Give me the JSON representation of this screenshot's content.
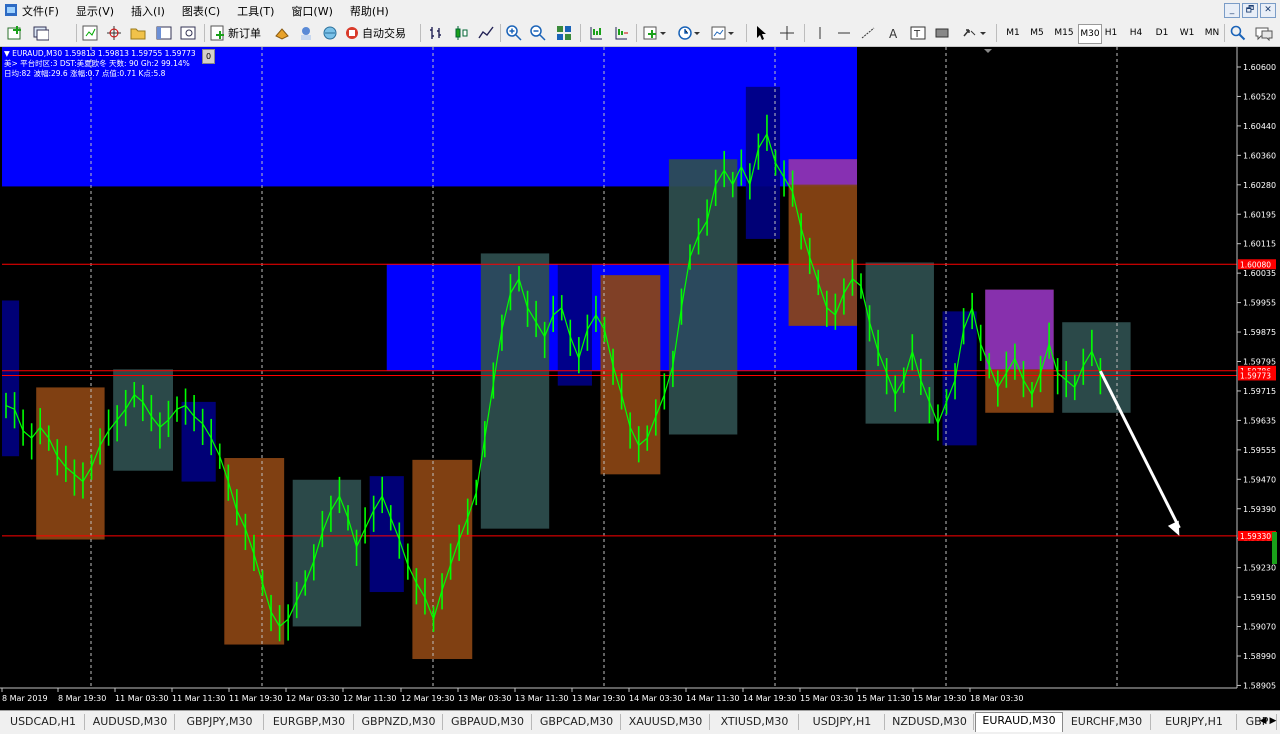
{
  "menu": [
    "文件(F)",
    "显示(V)",
    "插入(I)",
    "图表(C)",
    "工具(T)",
    "窗口(W)",
    "帮助(H)"
  ],
  "window_buttons": [
    "_",
    "🗗",
    "✕"
  ],
  "toolbar": {
    "new_order_label": "新订单",
    "auto_trading_label": "自动交易",
    "timeframes": [
      "M1",
      "M5",
      "M15",
      "M30",
      "H1",
      "H4",
      "D1",
      "W1",
      "MN"
    ],
    "active_timeframe": "M30"
  },
  "chart": {
    "header_line1": "EURAUD,M30  1.59813 1.59813 1.59755 1.59773",
    "header_line2": "美> 平台时区:3  DST:美夏欧冬 天数: 90  Gh:2  99.14%",
    "header_line3": "日均:82  波幅:29.6  涨幅:0.7  点值:0.71  K点:5.8",
    "zero_badge": "0",
    "colors": {
      "background": "#000000",
      "candles": "#00ff00",
      "blue_zone": "#0000ff",
      "navy_box": "#000080",
      "brown_box": "#8b4513",
      "slate_box": "#2f4f4f",
      "purple_box": "#8a2be2",
      "hline": "#ff0000",
      "grid": "#c0c0c0"
    }
  },
  "chart_data": {
    "type": "line",
    "symbol": "EURAUD",
    "timeframe": "M30",
    "ylim": [
      1.5891,
      1.6068
    ],
    "y_ticks": [
      "1.60600",
      "1.60520",
      "1.60440",
      "1.60360",
      "1.60280",
      "1.60195",
      "1.60115",
      "1.60035",
      "1.59955",
      "1.59875",
      "1.59795",
      "1.59715",
      "1.59635",
      "1.59555",
      "1.59470",
      "1.59390",
      "1.59310",
      "1.59230",
      "1.59150",
      "1.59070",
      "1.58990",
      "1.58905"
    ],
    "x_ticks": [
      "8 Mar 2019",
      "8 Mar 19:30",
      "11 Mar 03:30",
      "11 Mar 11:30",
      "11 Mar 19:30",
      "12 Mar 03:30",
      "12 Mar 11:30",
      "12 Mar 19:30",
      "13 Mar 03:30",
      "13 Mar 11:30",
      "13 Mar 19:30",
      "14 Mar 03:30",
      "14 Mar 11:30",
      "14 Mar 19:30",
      "15 Mar 03:30",
      "15 Mar 11:30",
      "15 Mar 19:30",
      "18 Mar 03:30"
    ],
    "price_labels": [
      {
        "text": "1.60080",
        "value": 1.6008
      },
      {
        "text": "1.59786",
        "value": 1.59786
      },
      {
        "text": "1.59773",
        "value": 1.59773
      },
      {
        "text": "1.59330",
        "value": 1.5933
      }
    ],
    "horizontal_lines": [
      1.6008,
      1.59786,
      1.59773,
      1.5933
    ],
    "blue_zones": [
      {
        "x_start": 0,
        "x_end": 100,
        "y_top": 1.6068,
        "y_bottom": 1.60295
      },
      {
        "x_start": 45,
        "x_end": 100,
        "y_top": 1.6008,
        "y_bottom": 1.59786
      }
    ],
    "boxes": [
      {
        "x": -1,
        "w": 3,
        "hi": 1.5998,
        "lo": 1.5955,
        "color": "navy"
      },
      {
        "x": 4,
        "w": 8,
        "hi": 1.5974,
        "lo": 1.5932,
        "color": "brown"
      },
      {
        "x": 13,
        "w": 7,
        "hi": 1.5979,
        "lo": 1.5951,
        "color": "slate"
      },
      {
        "x": 21,
        "w": 4,
        "hi": 1.597,
        "lo": 1.5948,
        "color": "navy"
      },
      {
        "x": 26,
        "w": 7,
        "hi": 1.59545,
        "lo": 1.5903,
        "color": "brown"
      },
      {
        "x": 34,
        "w": 8,
        "hi": 1.59485,
        "lo": 1.5908,
        "color": "slate"
      },
      {
        "x": 43,
        "w": 4,
        "hi": 1.59495,
        "lo": 1.59175,
        "color": "navy"
      },
      {
        "x": 48,
        "w": 7,
        "hi": 1.5954,
        "lo": 1.5899,
        "color": "brown"
      },
      {
        "x": 56,
        "w": 8,
        "hi": 1.6011,
        "lo": 1.5935,
        "color": "slate"
      },
      {
        "x": 65,
        "w": 4,
        "hi": 1.6008,
        "lo": 1.59745,
        "color": "navy"
      },
      {
        "x": 70,
        "w": 7,
        "hi": 1.6005,
        "lo": 1.595,
        "color": "brown"
      },
      {
        "x": 78,
        "w": 8,
        "hi": 1.6037,
        "lo": 1.5961,
        "color": "slate"
      },
      {
        "x": 87,
        "w": 4,
        "hi": 1.6057,
        "lo": 1.6015,
        "color": "navy"
      },
      {
        "x": 92,
        "w": 8,
        "hi": 1.6037,
        "lo": 1.5991,
        "color": "brown"
      },
      {
        "x": 92,
        "w": 8,
        "hi": 1.6037,
        "lo": 1.603,
        "color": "purple"
      },
      {
        "x": 101,
        "w": 8,
        "hi": 1.60085,
        "lo": 1.5964,
        "color": "slate"
      },
      {
        "x": 110,
        "w": 4,
        "hi": 1.5995,
        "lo": 1.5958,
        "color": "navy"
      },
      {
        "x": 115,
        "w": 8,
        "hi": 1.6001,
        "lo": 1.5967,
        "color": "brown"
      },
      {
        "x": 115,
        "w": 8,
        "hi": 1.6001,
        "lo": 1.5979,
        "color": "purple"
      },
      {
        "x": 124,
        "w": 8,
        "hi": 1.5992,
        "lo": 1.5967,
        "color": "slate"
      }
    ],
    "series": [
      {
        "x": [
          0,
          1,
          2,
          3,
          4,
          5,
          6,
          7,
          8,
          9,
          10,
          11,
          12,
          13,
          14,
          15,
          16,
          17,
          18,
          19,
          20,
          21,
          22,
          23,
          24,
          25,
          26,
          27,
          28,
          29,
          30,
          31,
          32,
          33,
          34,
          35,
          36,
          37,
          38,
          39,
          40,
          41,
          42,
          43,
          44,
          45,
          46,
          47,
          48,
          49,
          50,
          51,
          52,
          53,
          54,
          55,
          56,
          57,
          58,
          59,
          60,
          61,
          62,
          63,
          64,
          65,
          66,
          67,
          68,
          69,
          70,
          71,
          72,
          73,
          74,
          75,
          76,
          77,
          78,
          79,
          80,
          81,
          82,
          83,
          84,
          85,
          86,
          87,
          88,
          89,
          90,
          91,
          92,
          93,
          94,
          95,
          96,
          97,
          98,
          99,
          100,
          101,
          102,
          103,
          104,
          105,
          106,
          107,
          108,
          109,
          110,
          111,
          112,
          113,
          114,
          115,
          116,
          117,
          118,
          119,
          120,
          121,
          122,
          123,
          124,
          125,
          126,
          127,
          128
        ],
        "values": [
          1.5969,
          1.5968,
          1.5962,
          1.596,
          1.5963,
          1.596,
          1.5955,
          1.5952,
          1.595,
          1.5948,
          1.5952,
          1.5958,
          1.5962,
          1.5965,
          1.5968,
          1.5972,
          1.597,
          1.5966,
          1.5963,
          1.5965,
          1.5968,
          1.5969,
          1.5966,
          1.5964,
          1.596,
          1.5955,
          1.5948,
          1.594,
          1.5935,
          1.5928,
          1.592,
          1.5912,
          1.5908,
          1.591,
          1.5915,
          1.592,
          1.5926,
          1.5934,
          1.594,
          1.5944,
          1.5938,
          1.593,
          1.5935,
          1.594,
          1.5944,
          1.5938,
          1.5932,
          1.5925,
          1.592,
          1.5916,
          1.591,
          1.5918,
          1.5925,
          1.5932,
          1.5938,
          1.5945,
          1.596,
          1.5975,
          1.599,
          1.6,
          1.6004,
          1.5996,
          1.5992,
          1.5988,
          1.5994,
          1.5996,
          1.5988,
          1.5982,
          1.599,
          1.5994,
          1.599,
          1.598,
          1.5972,
          1.5963,
          1.5958,
          1.596,
          1.5966,
          1.5972,
          1.598,
          1.5996,
          1.601,
          1.6016,
          1.602,
          1.603,
          1.6034,
          1.603,
          1.6035,
          1.603,
          1.604,
          1.6044,
          1.6036,
          1.6032,
          1.6028,
          1.6018,
          1.601,
          1.6003,
          1.5996,
          1.5994,
          1.6,
          1.6004,
          1.6002,
          1.5992,
          1.5984,
          1.5978,
          1.5972,
          1.5976,
          1.5984,
          1.5976,
          1.597,
          1.5964,
          1.597,
          1.5976,
          1.599,
          1.5996,
          1.5986,
          1.598,
          1.5974,
          1.5978,
          1.5982,
          1.5976,
          1.5972,
          1.5978,
          1.5986,
          1.5978,
          1.5976,
          1.5974,
          1.598,
          1.5984,
          1.5978
        ]
      }
    ],
    "arrow": {
      "x_from": 128,
      "y_from": 1.59785,
      "x_to": 137,
      "y_to": 1.5933
    }
  },
  "tabs": [
    "USDCAD,H1",
    "AUDUSD,M30",
    "GBPJPY,M30",
    "EURGBP,M30",
    "GBPNZD,M30",
    "GBPAUD,M30",
    "GBPCAD,M30",
    "XAUUSD,M30",
    "XTIUSD,M30",
    "USDJPY,H1",
    "NZDUSD,M30",
    "EURAUD,M30",
    "EURCHF,M30",
    "EURJPY,H1",
    "GBP"
  ],
  "active_tab": "EURAUD,M30",
  "tab_scroll": [
    "◀",
    "▶"
  ]
}
